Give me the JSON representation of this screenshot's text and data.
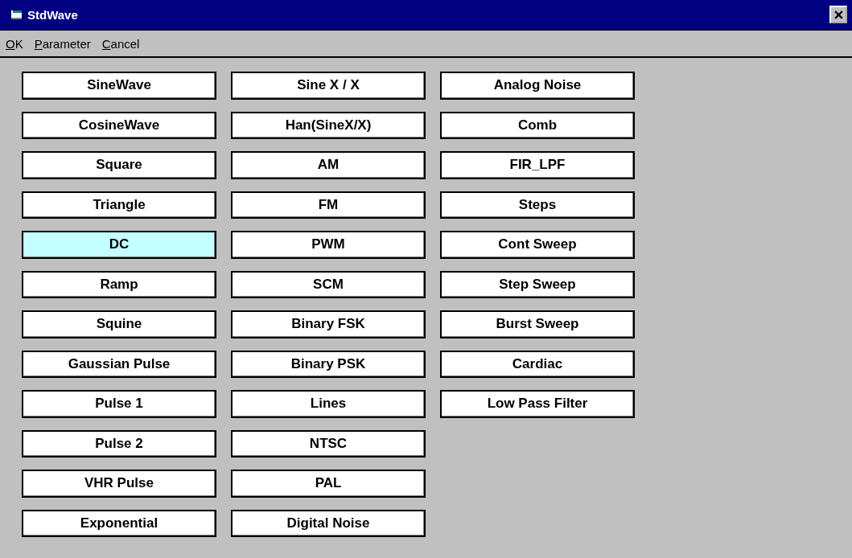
{
  "window": {
    "title": "StdWave"
  },
  "menu": [
    {
      "label": "OK"
    },
    {
      "label": "Parameter"
    },
    {
      "label": "Cancel"
    }
  ],
  "columns": [
    [
      {
        "label": "SineWave",
        "selected": false
      },
      {
        "label": "CosineWave",
        "selected": false
      },
      {
        "label": "Square",
        "selected": false
      },
      {
        "label": "Triangle",
        "selected": false
      },
      {
        "label": "DC",
        "selected": true
      },
      {
        "label": "Ramp",
        "selected": false
      },
      {
        "label": "Squine",
        "selected": false
      },
      {
        "label": "Gaussian Pulse",
        "selected": false
      },
      {
        "label": "Pulse 1",
        "selected": false
      },
      {
        "label": "Pulse 2",
        "selected": false
      },
      {
        "label": "VHR Pulse",
        "selected": false
      },
      {
        "label": "Exponential",
        "selected": false
      }
    ],
    [
      {
        "label": "Sine X / X",
        "selected": false
      },
      {
        "label": "Han(SineX/X)",
        "selected": false
      },
      {
        "label": "AM",
        "selected": false
      },
      {
        "label": "FM",
        "selected": false
      },
      {
        "label": "PWM",
        "selected": false
      },
      {
        "label": "SCM",
        "selected": false
      },
      {
        "label": "Binary FSK",
        "selected": false
      },
      {
        "label": "Binary PSK",
        "selected": false
      },
      {
        "label": "Lines",
        "selected": false
      },
      {
        "label": "NTSC",
        "selected": false
      },
      {
        "label": "PAL",
        "selected": false
      },
      {
        "label": "Digital Noise",
        "selected": false
      }
    ],
    [
      {
        "label": "Analog Noise",
        "selected": false
      },
      {
        "label": "Comb",
        "selected": false
      },
      {
        "label": "FIR_LPF",
        "selected": false
      },
      {
        "label": "Steps",
        "selected": false
      },
      {
        "label": "Cont Sweep",
        "selected": false
      },
      {
        "label": "Step Sweep",
        "selected": false
      },
      {
        "label": "Burst Sweep",
        "selected": false
      },
      {
        "label": "Cardiac",
        "selected": false
      },
      {
        "label": "Low Pass Filter",
        "selected": false
      }
    ]
  ]
}
